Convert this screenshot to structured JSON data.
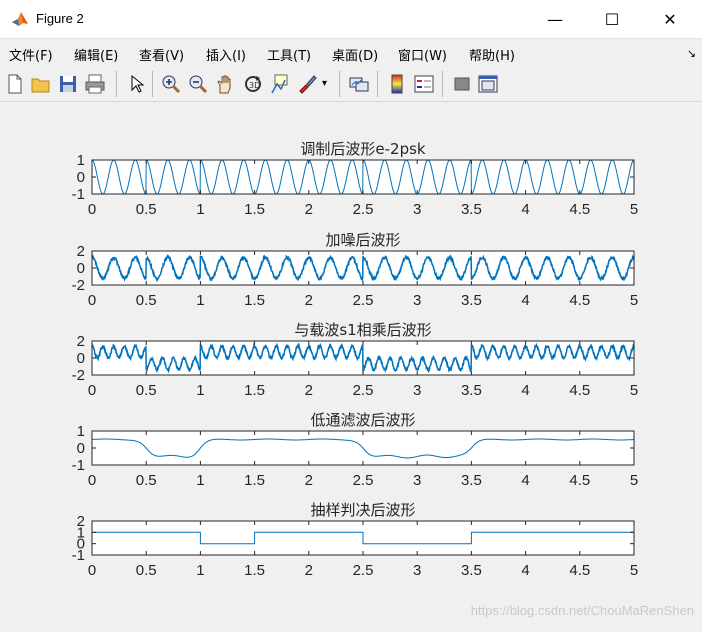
{
  "window": {
    "title": "Figure 2",
    "icon": "matlab-icon",
    "controls": {
      "minimize": "—",
      "maximize": "☐",
      "close": "✕"
    }
  },
  "menubar": {
    "items": [
      "文件(F)",
      "编辑(E)",
      "查看(V)",
      "插入(I)",
      "工具(T)",
      "桌面(D)",
      "窗口(W)",
      "帮助(H)"
    ],
    "dock_icon": "↘"
  },
  "toolbar": {
    "icons": [
      "new-figure-icon",
      "open-file-icon",
      "save-icon",
      "print-icon",
      "pointer-icon",
      "zoom-in-icon",
      "zoom-out-icon",
      "pan-icon",
      "rotate-3d-icon",
      "data-cursor-icon",
      "brush-icon",
      "link-plot-icon",
      "colorbar-icon",
      "legend-icon",
      "hide-plot-tools-icon",
      "show-plot-tools-icon"
    ]
  },
  "chart_data": [
    {
      "type": "line",
      "title": "调制后波形e-2psk",
      "xlim": [
        0,
        5
      ],
      "ylim": [
        -1,
        1
      ],
      "xticks": [
        "0",
        "0.5",
        "1",
        "1.5",
        "2",
        "2.5",
        "3",
        "3.5",
        "4",
        "4.5",
        "5"
      ],
      "yticks": [
        "1",
        "0",
        "-1"
      ],
      "carrier_frequency": 5,
      "bits": [
        1,
        0,
        1,
        1,
        1,
        0,
        0,
        1,
        1,
        1
      ],
      "bit_duration": 0.5,
      "color": "#0072bd"
    },
    {
      "type": "line",
      "title": "加噪后波形",
      "xlim": [
        0,
        5
      ],
      "ylim": [
        -2,
        2
      ],
      "xticks": [
        "0",
        "0.5",
        "1",
        "1.5",
        "2",
        "2.5",
        "3",
        "3.5",
        "4",
        "4.5",
        "5"
      ],
      "yticks": [
        "2",
        "0",
        "-2"
      ],
      "color": "#0072bd"
    },
    {
      "type": "line",
      "title": "与载波s1相乘后波形",
      "xlim": [
        0,
        5
      ],
      "ylim": [
        -2,
        2
      ],
      "xticks": [
        "0",
        "0.5",
        "1",
        "1.5",
        "2",
        "2.5",
        "3",
        "3.5",
        "4",
        "4.5",
        "5"
      ],
      "yticks": [
        "2",
        "0",
        "-2"
      ],
      "color": "#0072bd"
    },
    {
      "type": "line",
      "title": "低通滤波后波形",
      "xlim": [
        0,
        5
      ],
      "ylim": [
        -1,
        1
      ],
      "xticks": [
        "0",
        "0.5",
        "1",
        "1.5",
        "2",
        "2.5",
        "3",
        "3.5",
        "4",
        "4.5",
        "5"
      ],
      "yticks": [
        "1",
        "0",
        "-1"
      ],
      "levels": {
        "high": 0.5,
        "low": -0.5
      },
      "color": "#0072bd"
    },
    {
      "type": "line",
      "title": "抽样判决后波形",
      "xlim": [
        0,
        5
      ],
      "ylim": [
        -1,
        2
      ],
      "xticks": [
        "0",
        "0.5",
        "1",
        "1.5",
        "2",
        "2.5",
        "3",
        "3.5",
        "4",
        "4.5",
        "5"
      ],
      "yticks": [
        "2",
        "1",
        "0",
        "-1"
      ],
      "x": [
        0,
        1,
        1,
        1.5,
        1.5,
        2.5,
        2.5,
        3.5,
        3.5,
        5
      ],
      "y": [
        1,
        1,
        0,
        0,
        1,
        1,
        0,
        0,
        1,
        1
      ],
      "color": "#0072bd"
    }
  ],
  "watermark": "https://blog.csdn.net/ChouMaRenShen"
}
